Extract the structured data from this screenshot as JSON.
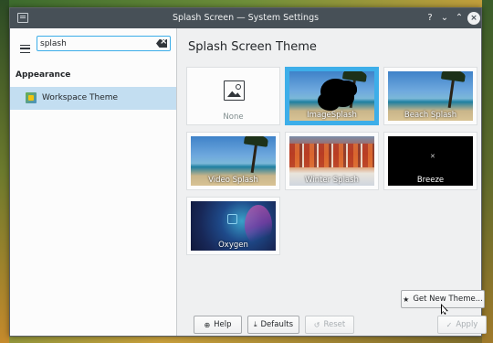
{
  "window": {
    "title": "Splash Screen — System Settings",
    "buttons": {
      "help": "?",
      "minimize": "⌄",
      "maximize": "⌃",
      "close": "×"
    }
  },
  "sidebar": {
    "search_value": "splash",
    "section": "Appearance",
    "items": [
      {
        "label": "Workspace Theme",
        "selected": true
      }
    ]
  },
  "main": {
    "title": "Splash Screen Theme",
    "themes": [
      {
        "label": "None",
        "selected": false
      },
      {
        "label": "ImageSplash",
        "selected": true
      },
      {
        "label": "Beach Splash",
        "selected": false
      },
      {
        "label": "Video Splash",
        "selected": false
      },
      {
        "label": "Winter Splash",
        "selected": false
      },
      {
        "label": "Breeze",
        "selected": false
      },
      {
        "label": "Oxygen",
        "selected": false
      }
    ],
    "get_new": "Get New Theme..."
  },
  "footer": {
    "help": "Help",
    "defaults": "Defaults",
    "reset": "Reset",
    "apply": "Apply"
  },
  "colors": {
    "accent": "#3daee9",
    "selection": "#c3def1",
    "titlebar": "#475057"
  }
}
